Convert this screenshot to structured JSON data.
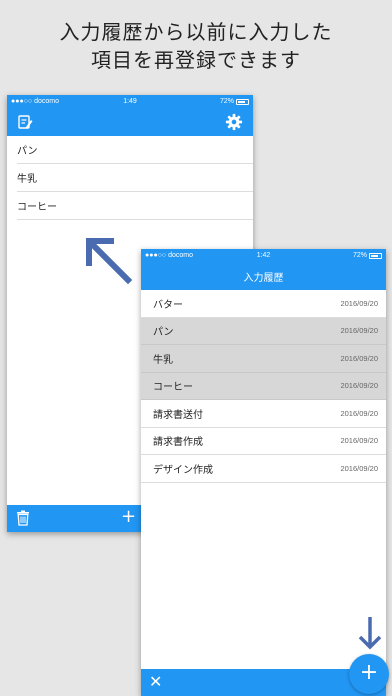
{
  "headline": {
    "line1": "入力履歴から以前に入力した",
    "line2": "項目を再登録できます"
  },
  "back_phone": {
    "status": {
      "carrier": "●●●○○ docomo",
      "time": "1:49",
      "battery": "72%"
    },
    "nav": {
      "left_icon": "note-edit-icon",
      "right_icon": "gear-icon"
    },
    "items": [
      {
        "label": "パン"
      },
      {
        "label": "牛乳"
      },
      {
        "label": "コーヒー"
      }
    ],
    "toolbar": {
      "left_icon": "trash-icon",
      "plus_label": "+"
    }
  },
  "front_phone": {
    "status": {
      "carrier": "●●●○○ docomo",
      "time": "1:42",
      "battery": "72%"
    },
    "nav": {
      "title": "入力履歴"
    },
    "items": [
      {
        "label": "バター",
        "date": "2016/09/20",
        "selected": false
      },
      {
        "label": "パン",
        "date": "2016/09/20",
        "selected": true
      },
      {
        "label": "牛乳",
        "date": "2016/09/20",
        "selected": true
      },
      {
        "label": "コーヒー",
        "date": "2016/09/20",
        "selected": true
      },
      {
        "label": "請求書送付",
        "date": "2016/09/20",
        "selected": false
      },
      {
        "label": "請求書作成",
        "date": "2016/09/20",
        "selected": false
      },
      {
        "label": "デザイン作成",
        "date": "2016/09/20",
        "selected": false
      }
    ],
    "toolbar": {
      "close_label": "✕",
      "fab_label": "+"
    }
  },
  "colors": {
    "accent": "#2196f3",
    "arrow": "#4a6bb0",
    "selected_row": "#d7d7d7",
    "background": "#e6e6e6"
  }
}
